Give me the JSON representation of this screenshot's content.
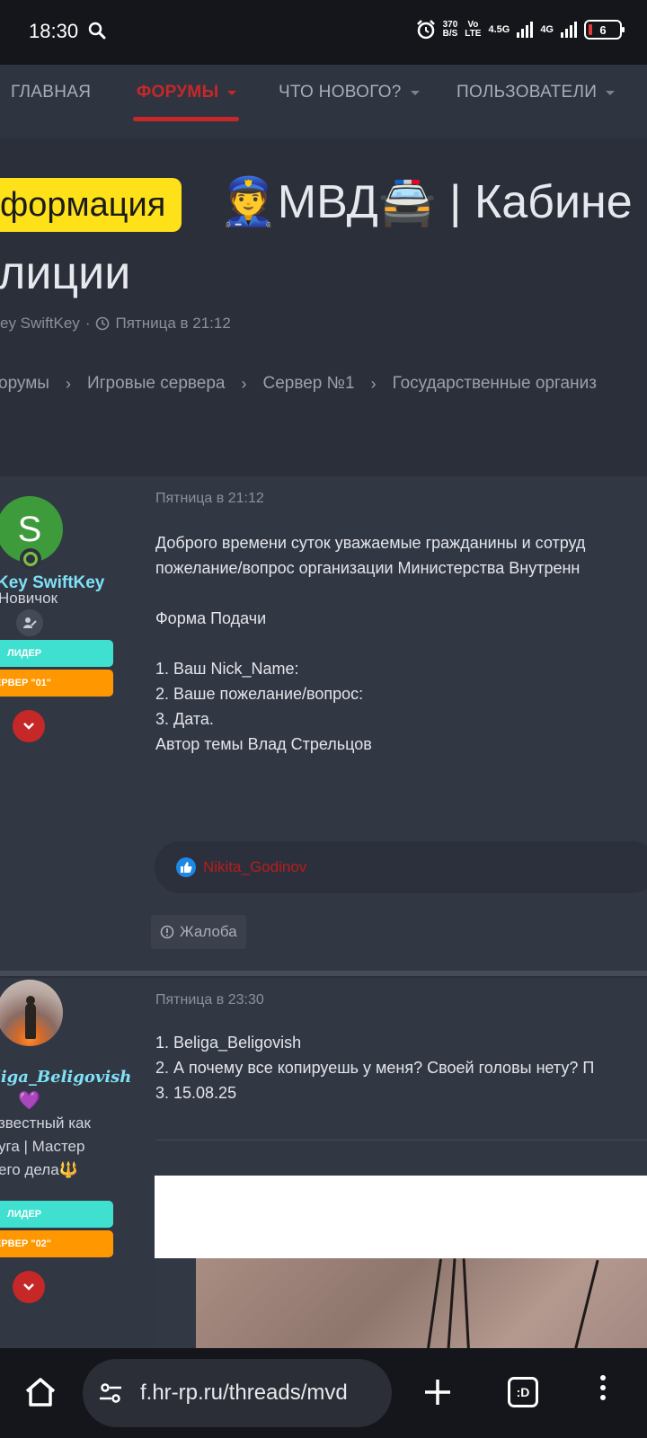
{
  "status_bar": {
    "time": "18:30",
    "net_speed_value": "370",
    "net_speed_unit": "B/S",
    "volte_top": "Vo",
    "volte_bottom": "LTE",
    "net_type1": "4.5G",
    "net_type2": "4G",
    "battery": "6",
    "icons": [
      "search-icon",
      "alarm-icon",
      "signal-icon",
      "battery-icon"
    ]
  },
  "nav": {
    "items": [
      {
        "label": "ГЛАВНАЯ"
      },
      {
        "label": "ФОРУМЫ"
      },
      {
        "label": "ЧТО НОВОГО?"
      },
      {
        "label": "ПОЛЬЗОВАТЕЛИ"
      }
    ],
    "accent": "#c62828"
  },
  "thread": {
    "prefix": "формация",
    "title_line1": "👮МВД🚔 | Кабине",
    "title_line2": "лиции",
    "author": "ey SwiftKey",
    "meta_sep": "·",
    "date": "Пятница в 21:12"
  },
  "breadcrumb": [
    "орумы",
    "Игровые сервера",
    "Сервер №1",
    "Государственные организ"
  ],
  "posts": [
    {
      "avatar_letter": "S",
      "username": "Key SwiftKey",
      "user_title": "Новичок",
      "badges": [
        "ЛИДЕР",
        "ЕРВЕР \"01\""
      ],
      "date": "Пятница в 21:12",
      "body": [
        "Доброго времени суток уважаемые гражданины и сотруд",
        "пожелание/вопрос организации Министерства Внутренн",
        "",
        "Форма Подачи",
        "",
        "1. Ваш Nick_Name:",
        "2. Ваше пожелание/вопрос:",
        "3. Дата.",
        "Автор темы Влад Стрельцов"
      ],
      "reaction_user": "Nikita_Godinov",
      "report_label": "Жалоба"
    },
    {
      "username": "liga_Beligovish",
      "heart": "💜",
      "user_title_lines": [
        "звестный как",
        "уга | Мастер",
        "его дела🔱"
      ],
      "badges": [
        "ЛИДЕР",
        "ЕРВЕР \"02\""
      ],
      "date": "Пятница в 23:30",
      "body": [
        "1. Beliga_Beligovish",
        "2. А почему все копируешь у меня? Своей головы нету? П",
        "3. 15.08.25"
      ]
    }
  ],
  "browser": {
    "url": "f.hr-rp.ru/threads/mvd",
    "tabs_label": ":D"
  }
}
